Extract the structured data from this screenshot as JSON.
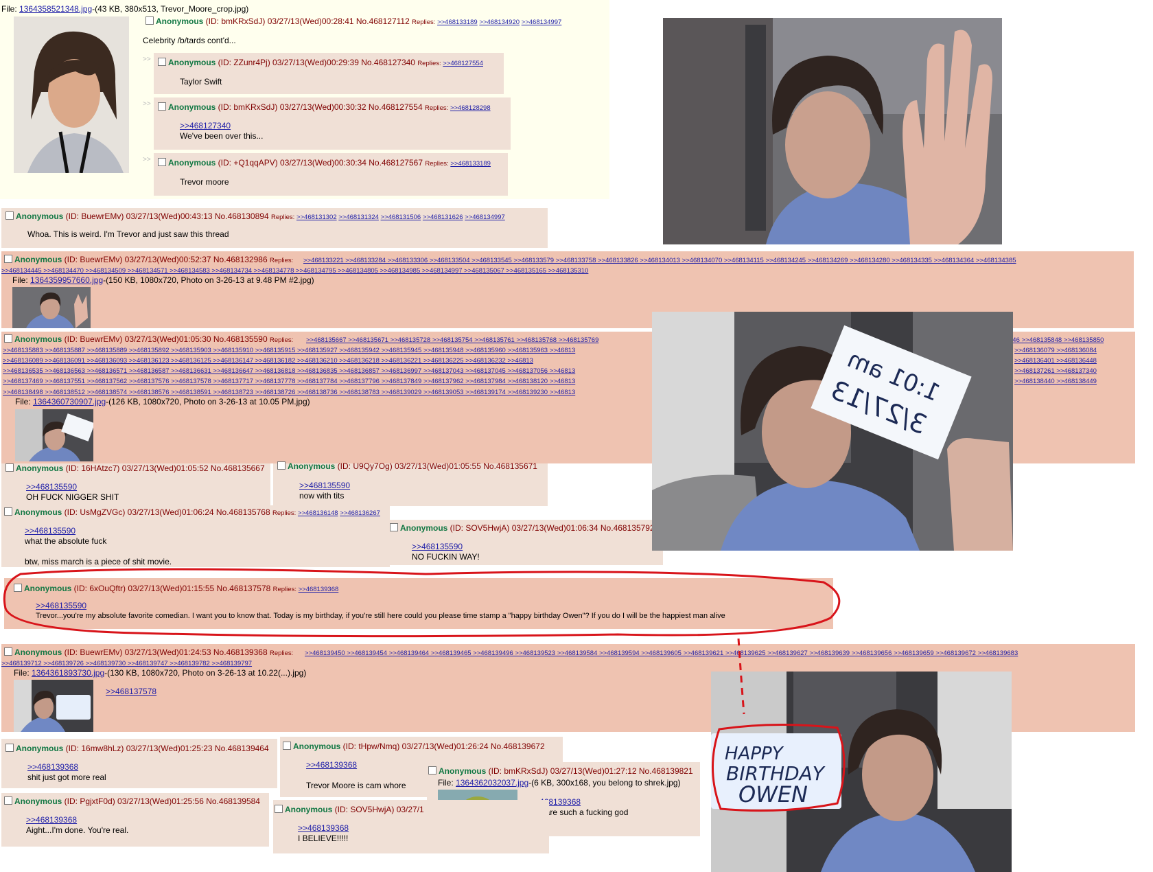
{
  "op": {
    "file_label": "File: ",
    "file_link": "1364358521348.jpg",
    "file_meta": "-(43 KB, 380x513, Trevor_Moore_crop.jpg)",
    "name": "Anonymous",
    "meta": " (ID: bmKRxSdJ) 03/27/13(Wed)00:28:41 No.468127112",
    "replies_label": "Replies:",
    "replies": [
      ">>468133189",
      ">>468134920",
      ">>468134997"
    ],
    "text": "Celebrity /b/tards cont'd..."
  },
  "arrow": ">>",
  "p1": {
    "name": "Anonymous",
    "meta": " (ID: ZZunr4Pj) 03/27/13(Wed)00:29:39 No.468127340",
    "replies_label": "Replies:",
    "replies": [
      ">>468127554"
    ],
    "text": "Taylor Swift"
  },
  "p2": {
    "name": "Anonymous",
    "meta": " (ID: bmKRxSdJ) 03/27/13(Wed)00:30:32 No.468127554",
    "replies_label": "Replies:",
    "replies": [
      ">>468128298"
    ],
    "quote": ">>468127340",
    "text": "We've been over this..."
  },
  "p3": {
    "name": "Anonymous",
    "meta": " (ID: +Q1qqAPV) 03/27/13(Wed)00:30:34 No.468127567",
    "replies_label": "Replies:",
    "replies": [
      ">>468133189"
    ],
    "text": "Trevor moore"
  },
  "p4": {
    "name": "Anonymous",
    "meta": " (ID: BuewrEMv) 03/27/13(Wed)00:43:13 No.468130894",
    "replies_label": "Replies:",
    "replies": [
      ">>468131302",
      ">>468131324",
      ">>468131506",
      ">>468131626",
      ">>468134997"
    ],
    "text": "Whoa. This is weird. I'm Trevor and just saw this thread"
  },
  "p5": {
    "name": "Anonymous",
    "meta": " (ID: BuewrEMv) 03/27/13(Wed)00:52:37 No.468132986",
    "replies_label": "Replies:",
    "replies_row1": ">>468133221 >>468133284 >>468133306 >>468133504 >>468133545 >>468133579 >>468133758 >>468133826 >>468134013 >>468134070 >>468134115 >>468134245 >>468134269 >>468134280 >>468134335 >>468134364 >>468134385",
    "replies_row2": ">>468134445 >>468134470 >>468134509 >>468134571 >>468134583 >>468134734 >>468134778 >>468134795 >>468134805 >>468134985 >>468134997 >>468135067 >>468135165 >>468135310",
    "file_label": "File: ",
    "file_link": "1364359957660.jpg",
    "file_meta": "-(150 KB, 1080x720, Photo on 3-26-13 at 9.48 PM #2.jpg)"
  },
  "p6": {
    "name": "Anonymous",
    "meta": " (ID: BuewrEMv) 03/27/13(Wed)01:05:30 No.468135590",
    "replies_label": "Replies:",
    "replies_row1": ">>468135667 >>468135671 >>468135728 >>468135754 >>468135761 >>468135768 >>468135769",
    "replies_row1_right": "846 >>468135848 >>468135850",
    "replies_row2": ">>468135883 >>468135887 >>468135889 >>468135892 >>468135903 >>468135910 >>468135915 >>468135927 >>468135942 >>468135945 >>468135948 >>468135960 >>468135963 >>46813",
    "replies_row2_right": ">>468136079 >>468136084",
    "replies_row3": ">>468136089 >>468136091 >>468136093 >>468136123 >>468136125 >>468136147 >>468136182 >>468136210 >>468136218 >>468136221 >>468136225 >>468136232 >>46813",
    "replies_row3_right": ">>468136401 >>468136448",
    "replies_row4": ">>468136535 >>468136563 >>468136571 >>468136587 >>468136631 >>468136647 >>468136818 >>468136835 >>468136857 >>468136997 >>468137043 >>468137045 >>468137056 >>46813",
    "replies_row4_right": ">>468137261 >>468137340",
    "replies_row5": ">>468137469 >>468137551 >>468137562 >>468137576 >>468137578 >>468137717 >>468137778 >>468137784 >>468137796 >>468137849 >>468137962 >>468137984 >>468138120 >>46813",
    "replies_row6": ">>468138498 >>468138512 >>468138574 >>468138576 >>468138591 >>468138723 >>468138726 >>468138736 >>468138783 >>468139029 >>468139053 >>468139174 >>468139230 >>46813",
    "replies_row6_right": ">>468138440 >>468138449",
    "file_label": "File: ",
    "file_link": "1364360730907.jpg",
    "file_meta": "-(126 KB, 1080x720, Photo on 3-26-13 at 10.05 PM.jpg)"
  },
  "p7": {
    "name": "Anonymous",
    "meta": " (ID: 16HAtzc7) 03/27/13(Wed)01:05:52 No.468135667",
    "quote": ">>468135590",
    "text": "OH FUCK NIGGER SHIT"
  },
  "p8": {
    "name": "Anonymous",
    "meta": " (ID: U9Qy7Og) 03/27/13(Wed)01:05:55 No.468135671",
    "quote": ">>468135590",
    "text": "now with tits"
  },
  "p9": {
    "name": "Anonymous",
    "meta": " (ID: UsMgZVGc) 03/27/13(Wed)01:06:24 No.468135768",
    "replies_label": "Replies:",
    "replies": [
      ">>468136148",
      ">>468136267"
    ],
    "quote": ">>468135590",
    "text1": "what the absolute fuck",
    "text2": "btw, miss march is a piece of shit movie."
  },
  "p10": {
    "name": "Anonymous",
    "meta": " (ID: SOV5HwjA) 03/27/13(Wed)01:06:34 No.468135792",
    "quote": ">>468135590",
    "text": "NO FUCKIN WAY!"
  },
  "p11": {
    "name": "Anonymous",
    "meta": " (ID: 6xOuQftr) 03/27/13(Wed)01:15:55 No.468137578",
    "replies_label": "Replies:",
    "replies": [
      ">>468139368"
    ],
    "quote": ">>468135590",
    "text": "Trevor...you're my absolute favorite comedian. I want you to know that. Today is my birthday, if you're still here could you please time stamp a \"happy birthday Owen\"? If you do I will be the happiest man alive"
  },
  "p12": {
    "name": "Anonymous",
    "meta": " (ID: BuewrEMv) 03/27/13(Wed)01:24:53 No.468139368",
    "replies_label": "Replies:",
    "replies_row1": ">>468139450 >>468139454 >>468139464 >>468139465 >>468139496 >>468139523 >>468139584 >>468139594 >>468139605 >>468139621 >>468139625 >>468139627 >>468139639 >>468139656 >>468139659 >>468139672 >>468139683",
    "replies_row2": ">>468139712 >>468139726 >>468139730 >>468139747 >>468139782 >>468139797",
    "file_label": "File: ",
    "file_link": "1364361893730.jpg",
    "file_meta": "-(130 KB, 1080x720, Photo on 3-26-13 at 10.22(...).jpg)",
    "quote": ">>468137578"
  },
  "p13": {
    "name": "Anonymous",
    "meta": " (ID: 16mw8hLz) 03/27/13(Wed)01:25:23 No.468139464",
    "quote": ">>468139368",
    "text": "shit just got more real"
  },
  "p14": {
    "name": "Anonymous",
    "meta": " (ID: tHpw/Nmq) 03/27/13(Wed)01:26:24 No.468139672",
    "quote": ">>468139368",
    "text": "Trevor Moore is cam whore"
  },
  "p15": {
    "name": "Anonymous",
    "meta": " (ID: bmKRxSdJ) 03/27/13(Wed)01:27:12 No.468139821",
    "file_label": "File: ",
    "file_link": "1364362032037.jpg",
    "file_meta": "-(6 KB, 300x168, you belong to shrek.jpg)",
    "quote": ">>468139368",
    "text": "you are such a fucking god"
  },
  "p16": {
    "name": "Anonymous",
    "meta": " (ID: PgjxtF0d) 03/27/13(Wed)01:25:56 No.468139584",
    "quote": ">>468139368",
    "text": "Aight...I'm done. You're real."
  },
  "p17": {
    "name": "Anonymous",
    "meta": " (ID: SOV5HwjA) 03/27/1",
    "quote": ">>468139368",
    "text": "I BELIEVE!!!!!"
  },
  "sign1": {
    "line1": "1:01 am",
    "line2": "3/27/13"
  },
  "sign2": {
    "line1": "HAPPY",
    "line2": "BIRTHDAY",
    "line3": "OWEN"
  },
  "colors": {
    "op_bg": "#ffffee",
    "post_bg": "#f0e0d6",
    "highlight_bg": "#efc3b1",
    "name": "#117743",
    "link": "#1f1fa8",
    "circle": "#d8141a"
  }
}
